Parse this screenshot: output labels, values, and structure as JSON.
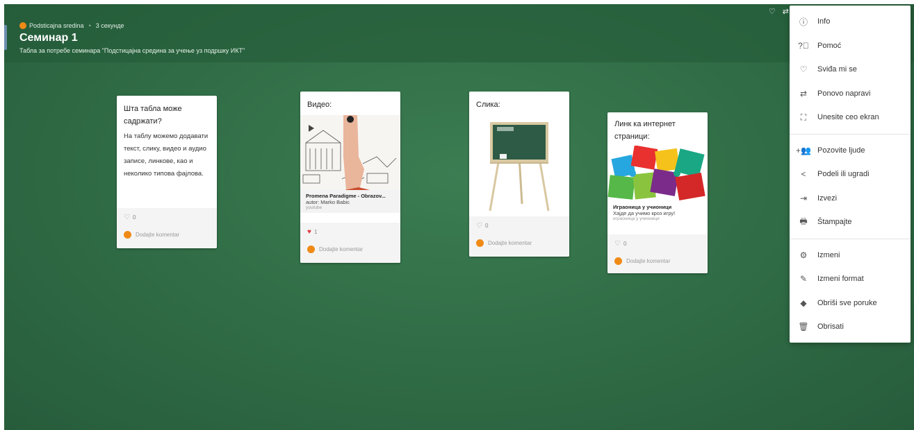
{
  "header": {
    "owner": "Podsticajna sredina",
    "time": "3 секунде",
    "title": "Семинар 1",
    "subtitle": "Табла за потребе семинара \"Подстицајна средина за учење уз подршку ИКТ\""
  },
  "cards": {
    "text": {
      "title": "Шта табла може садржати?",
      "body": "На таблу можемо додавати текст, слику, видео и аудио записе, линкове, као и неколико типова фајлова.",
      "likes": "0",
      "comment": "Dodajte komentar"
    },
    "video": {
      "title": "Видео:",
      "attach_title": "Promena Paradigme - Obrazov...",
      "attach_author": "autor: Marko Babic",
      "attach_source": "youtube",
      "likes": "1",
      "comment": "Dodajte komentar"
    },
    "image": {
      "title": "Слика:",
      "likes": "0",
      "comment": "Dodajte komentar"
    },
    "link": {
      "title": "Линк ка интернет страници:",
      "attach_title": "Играоница у учионици",
      "attach_author": "Хајде да учимо кроз игру!",
      "attach_source": "играоница у учионици",
      "likes": "0",
      "comment": "Dodajte komentar"
    }
  },
  "menu": {
    "items": [
      {
        "label": "Info",
        "icon": "info-icon"
      },
      {
        "label": "Pomoć",
        "icon": "help-icon"
      },
      {
        "label": "Sviđa mi se",
        "icon": "heart-icon"
      },
      {
        "label": "Ponovo napravi",
        "icon": "remake-icon"
      },
      {
        "label": "Unesite ceo ekran",
        "icon": "fullscreen-icon"
      },
      {
        "label": "Pozovite ljude",
        "icon": "invite-icon"
      },
      {
        "label": "Podeli ili ugradi",
        "icon": "share-icon"
      },
      {
        "label": "Izvezi",
        "icon": "export-icon"
      },
      {
        "label": "Štampajte",
        "icon": "print-icon"
      },
      {
        "label": "Izmeni",
        "icon": "settings-gear-icon"
      },
      {
        "label": "Izmeni format",
        "icon": "format-icon"
      },
      {
        "label": "Obriši sve poruke",
        "icon": "eraser-icon"
      },
      {
        "label": "Obrisati",
        "icon": "trash-icon"
      }
    ]
  },
  "colors": {
    "board_bg": "#2f6b45",
    "avatar": "#f08a17",
    "like_active": "#e0383f"
  }
}
